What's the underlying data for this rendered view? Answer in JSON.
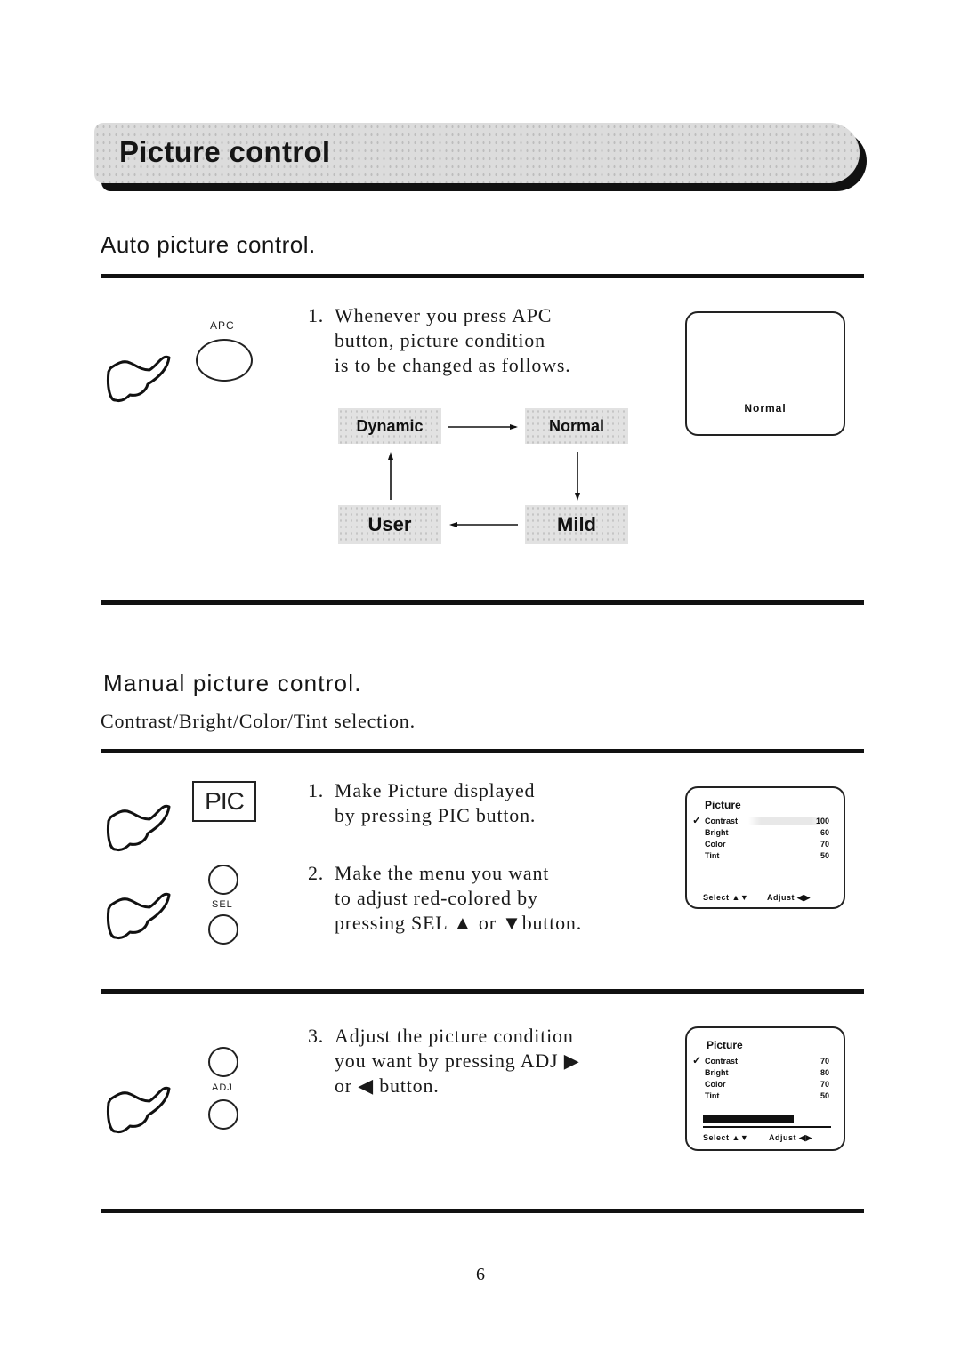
{
  "header": {
    "title": "Picture control"
  },
  "auto_section": {
    "heading": "Auto picture control.",
    "button_label": "APC",
    "step1": {
      "number": "1.",
      "lines": [
        "Whenever you press APC",
        "button, picture condition",
        "is to be changed as follows."
      ]
    },
    "cycle": {
      "states": [
        "Dynamic",
        "Normal",
        "Mild",
        "User"
      ],
      "order": "Dynamic → Normal → Mild → User → Dynamic"
    },
    "screen": {
      "label": "Normal"
    }
  },
  "manual_section": {
    "heading": "Manual picture control.",
    "subheading": "Contrast/Bright/Color/Tint selection.",
    "pic_button_label": "PIC",
    "sel_button_label": "SEL",
    "adj_button_label": "ADJ",
    "step1": {
      "number": "1.",
      "lines": [
        "Make Picture displayed",
        "by pressing PIC button."
      ]
    },
    "step2": {
      "number": "2.",
      "lines": [
        "Make the menu you want",
        "to adjust red-colored by",
        "pressing SEL ▲ or ▼button."
      ]
    },
    "step3": {
      "number": "3.",
      "lines": [
        "Adjust the picture condition",
        "you want by pressing ADJ ▶",
        "or ◀ button."
      ]
    },
    "menu1": {
      "title": "Picture",
      "selected": "Contrast",
      "items": [
        {
          "label": "Contrast",
          "value": "100"
        },
        {
          "label": "Bright",
          "value": "60"
        },
        {
          "label": "Color",
          "value": "70"
        },
        {
          "label": "Tint",
          "value": "50"
        }
      ],
      "footer_select": "Select ▲▼",
      "footer_adjust": "Adjust ◀▶"
    },
    "menu2": {
      "title": "Picture",
      "selected": "Contrast",
      "items": [
        {
          "label": "Contrast",
          "value": "70"
        },
        {
          "label": "Bright",
          "value": "80"
        },
        {
          "label": "Color",
          "value": "70"
        },
        {
          "label": "Tint",
          "value": "50"
        }
      ],
      "adjust_bar_level_percent": 70,
      "footer_select": "Select ▲▼",
      "footer_adjust": "Adjust ◀▶"
    }
  },
  "footer": {
    "page_number": "6"
  }
}
